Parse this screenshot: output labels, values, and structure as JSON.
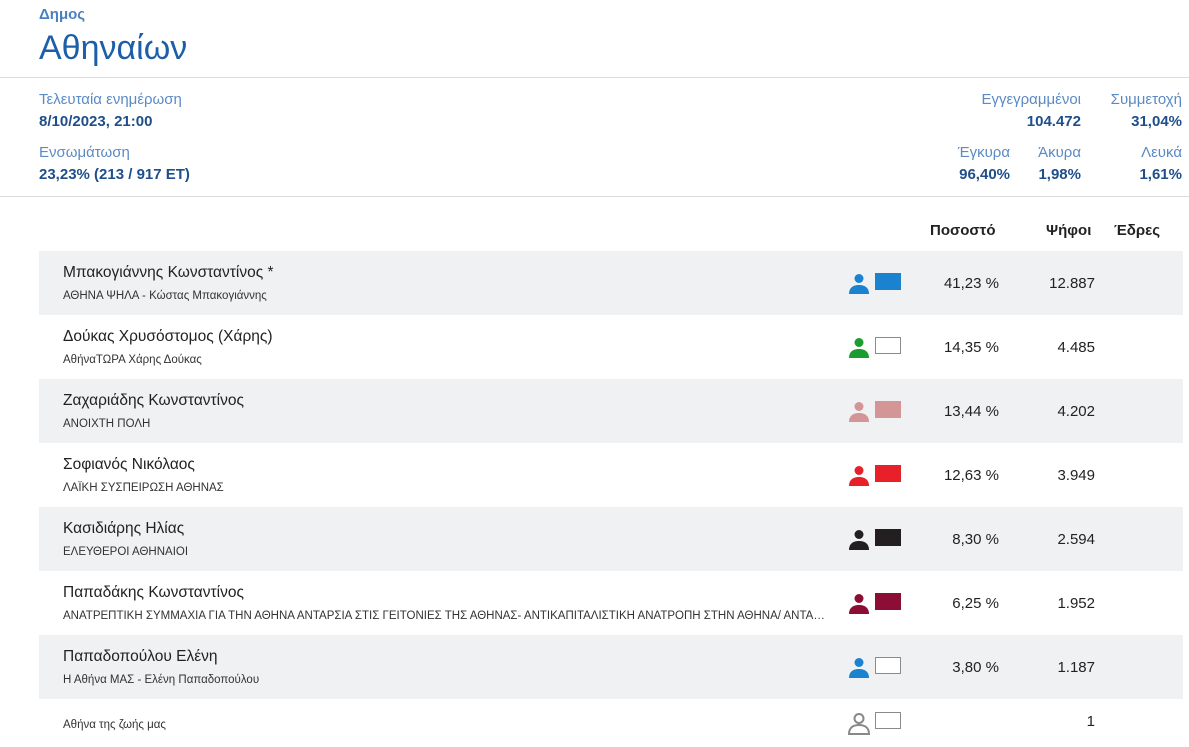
{
  "header": {
    "subtitle": "Δημος",
    "title": "Αθηναίων"
  },
  "meta": {
    "last_update_label": "Τελευταία ενημέρωση",
    "last_update_value": "8/10/2023, 21:00",
    "integration_label": "Ενσωμάτωση",
    "integration_value": "23,23% (213 / 917 ΕΤ)",
    "registered_label": "Εγγεγραμμένοι",
    "registered_value": "104.472",
    "turnout_label": "Συμμετοχή",
    "turnout_value": "31,04%",
    "valid_label": "Έγκυρα",
    "valid_value": "96,40%",
    "invalid_label": "Άκυρα",
    "invalid_value": "1,98%",
    "blank_label": "Λευκά",
    "blank_value": "1,61%"
  },
  "columns": {
    "percent": "Ποσοστό",
    "votes": "Ψήφοι",
    "seats": "Έδρες"
  },
  "candidates": [
    {
      "name": "Μπακογιάννης Κωνσταντίνος *",
      "party": "ΑΘΗΝΑ ΨΗΛΑ - Κώστας Μπακογιάννης",
      "percent": "41,23 %",
      "votes": "12.887",
      "color": "#1b82d0",
      "icon_color": "#1b82d0",
      "icon": "person-icon"
    },
    {
      "name": "Δούκας Χρυσόστομος (Χάρης)",
      "party": "ΑθήναΤΩΡΑ Χάρης Δούκας",
      "percent": "14,35 %",
      "votes": "4.485",
      "color": "#ffffff",
      "icon_color": "#1a9c2e",
      "icon": "person-icon"
    },
    {
      "name": "Ζαχαριάδης Κωνσταντίνος",
      "party": "ΑΝΟΙΧΤΗ ΠΟΛΗ",
      "percent": "13,44 %",
      "votes": "4.202",
      "color": "#d39595",
      "icon_color": "#d39595",
      "icon": "person-icon"
    },
    {
      "name": "Σοφιανός Νικόλαος",
      "party": "ΛΑΪΚΗ ΣΥΣΠΕΙΡΩΣΗ ΑΘΗΝΑΣ",
      "percent": "12,63 %",
      "votes": "3.949",
      "color": "#e8202a",
      "icon_color": "#e8202a",
      "icon": "person-icon"
    },
    {
      "name": "Κασιδιάρης Ηλίας",
      "party": "ΕΛΕΥΘΕΡΟΙ ΑΘΗΝΑΙΟΙ",
      "percent": "8,30 %",
      "votes": "2.594",
      "color": "#231f20",
      "icon_color": "#231f20",
      "icon": "person-icon"
    },
    {
      "name": "Παπαδάκης Κωνσταντίνος",
      "party": "ΑΝΑΤΡΕΠΤΙΚΗ ΣΥΜΜΑΧΙΑ ΓΙΑ ΤΗΝ ΑΘΗΝΑ ΑΝΤΑΡΣΙΑ ΣΤΙΣ ΓΕΙΤΟΝΙΕΣ ΤΗΣ ΑΘΗΝΑΣ- ΑΝΤΙΚΑΠΙΤΑΛΙΣΤΙΚΗ ΑΝΑΤΡΟΠΗ ΣΤΗΝ ΑΘΗΝΑ/ ΑΝΤΑΡΣΙΑ",
      "percent": "6,25 %",
      "votes": "1.952",
      "color": "#8c0e35",
      "icon_color": "#8c0e35",
      "icon": "person-icon"
    },
    {
      "name": "Παπαδοπούλου Ελένη",
      "party": "Η Αθήνα ΜΑΣ - Ελένη Παπαδοπούλου",
      "percent": "3,80 %",
      "votes": "1.187",
      "color": "#ffffff",
      "icon_color": "#1b82d0",
      "icon": "person-icon"
    },
    {
      "name": "",
      "party": "Αθήνα της ζωής μας",
      "percent": "",
      "votes": "1",
      "color": "#ffffff",
      "icon_color": "#888888",
      "icon": "person-outline-icon"
    }
  ]
}
